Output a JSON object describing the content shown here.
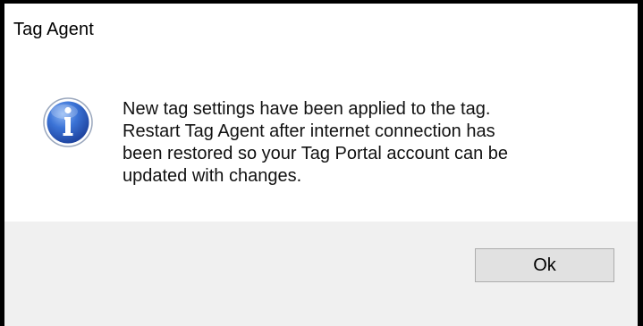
{
  "window": {
    "title": "Tag Agent"
  },
  "dialog": {
    "icon": "information-icon",
    "message_lines": [
      "New tag settings have been applied to the tag.",
      "Restart Tag Agent after internet connection has",
      "been restored so your Tag Portal account can be",
      "updated with changes."
    ]
  },
  "buttons": {
    "ok_label": "Ok"
  },
  "colors": {
    "icon_blue": "#2f63c4",
    "footer_background": "#f0f0f0",
    "button_face": "#e1e1e1",
    "button_border": "#adadad"
  }
}
